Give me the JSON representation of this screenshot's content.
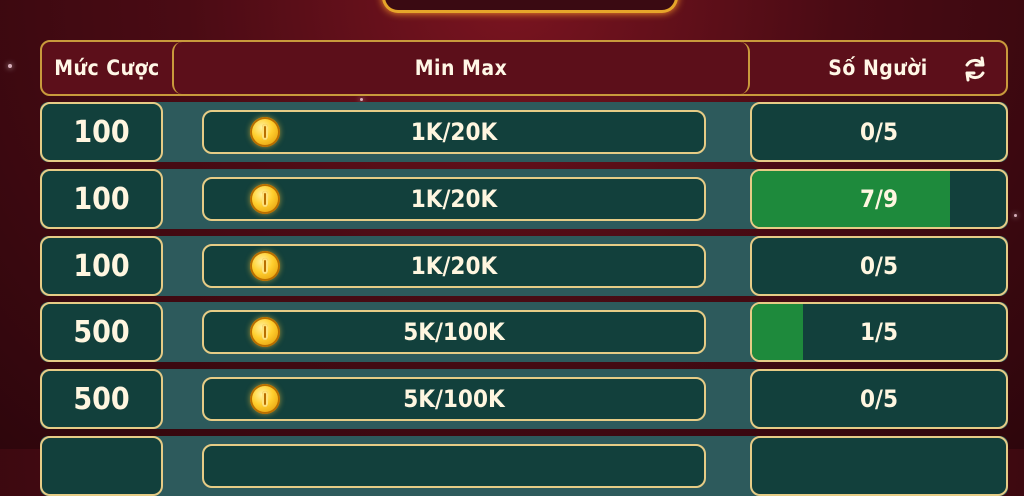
{
  "header": {
    "bet_label": "Mức Cược",
    "minmax_label": "Min Max",
    "players_label": "Số Người",
    "refresh_icon": "refresh-icon"
  },
  "rows": [
    {
      "bet": "100",
      "minmax": "1K/20K",
      "players": "0/5",
      "fill": 0
    },
    {
      "bet": "100",
      "minmax": "1K/20K",
      "players": "7/9",
      "fill": 0.78
    },
    {
      "bet": "100",
      "minmax": "1K/20K",
      "players": "0/5",
      "fill": 0
    },
    {
      "bet": "500",
      "minmax": "5K/100K",
      "players": "1/5",
      "fill": 0.2
    },
    {
      "bet": "500",
      "minmax": "5K/100K",
      "players": "0/5",
      "fill": 0
    }
  ],
  "colors": {
    "fill": "#1e8a3c",
    "cell": "#12403c",
    "border": "#e6cc86",
    "background": "#4a0b14"
  }
}
